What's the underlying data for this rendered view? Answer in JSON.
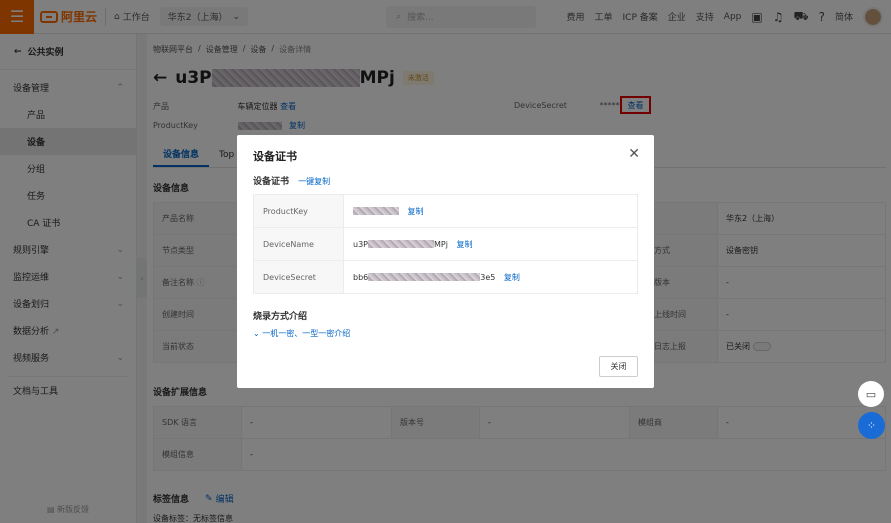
{
  "topbar": {
    "logo": "阿里云",
    "workbench": "工作台",
    "region": "华东2（上海）",
    "search_placeholder": "搜索...",
    "links": [
      "费用",
      "工单",
      "ICP 备案",
      "企业",
      "支持",
      "App"
    ],
    "lang": "简体"
  },
  "sidebar": {
    "back": "公共实例",
    "groups": {
      "device_mgmt": "设备管理",
      "product": "产品",
      "device": "设备",
      "group": "分组",
      "task": "任务",
      "ca": "CA 证书",
      "rules": "规则引擎",
      "monitor": "监控运维",
      "device_plan": "设备划归",
      "analysis": "数据分析",
      "video": "视频服务",
      "docs": "文档与工具"
    },
    "feedback": "新版反馈"
  },
  "breadcrumb": [
    "物联网平台",
    "/",
    "设备管理",
    "/",
    "设备",
    "/",
    "设备详情"
  ],
  "device": {
    "name_prefix": "u3P",
    "name_suffix": "MPj",
    "status": "未激活",
    "product_label": "产品",
    "product_value": "车辆定位器",
    "view": "查看",
    "productkey_label": "ProductKey",
    "copy": "复制",
    "secret_label": "DeviceSecret",
    "secret_mask": "*******",
    "view_highlight": "查看"
  },
  "tabs": [
    "设备信息",
    "Top"
  ],
  "device_info": {
    "title": "设备信息",
    "rows": [
      {
        "k": "产品名称",
        "k2": "",
        "v2": "华东2（上海）"
      },
      {
        "k": "节点类型",
        "k2": "认证方式",
        "v2": "设备密钥"
      },
      {
        "k": "备注名称",
        "k2": "固件版本",
        "v2": "-"
      },
      {
        "k": "创建时间",
        "k2": "最后上线时间",
        "v2": "-"
      },
      {
        "k": "当前状态",
        "k2": "本地日志上报",
        "v2": "已关闭"
      }
    ]
  },
  "ext_info": {
    "title": "设备扩展信息",
    "sdk_label": "SDK 语言",
    "sdk_value": "-",
    "version_label": "版本号",
    "version_value": "-",
    "module_vendor_label": "模组商",
    "module_vendor_value": "-",
    "module_info_label": "模组信息",
    "module_info_value": "-"
  },
  "tag_info": {
    "title": "标签信息",
    "edit": "编辑",
    "value": "设备标签：无标签信息"
  },
  "modal": {
    "title": "设备证书",
    "cert_head": "设备证书",
    "copy_all": "一键复制",
    "rows": [
      {
        "k": "ProductKey",
        "v_prefix": "",
        "v_suffix": "",
        "copy": "复制"
      },
      {
        "k": "DeviceName",
        "v_prefix": "u3P",
        "v_suffix": "MPj",
        "copy": "复制"
      },
      {
        "k": "DeviceSecret",
        "v_prefix": "bb6",
        "v_suffix": "3e5",
        "copy": "复制"
      }
    ],
    "method_head": "烧录方式介绍",
    "method_link": "一机一密、一型一密介绍",
    "close": "关闭"
  }
}
